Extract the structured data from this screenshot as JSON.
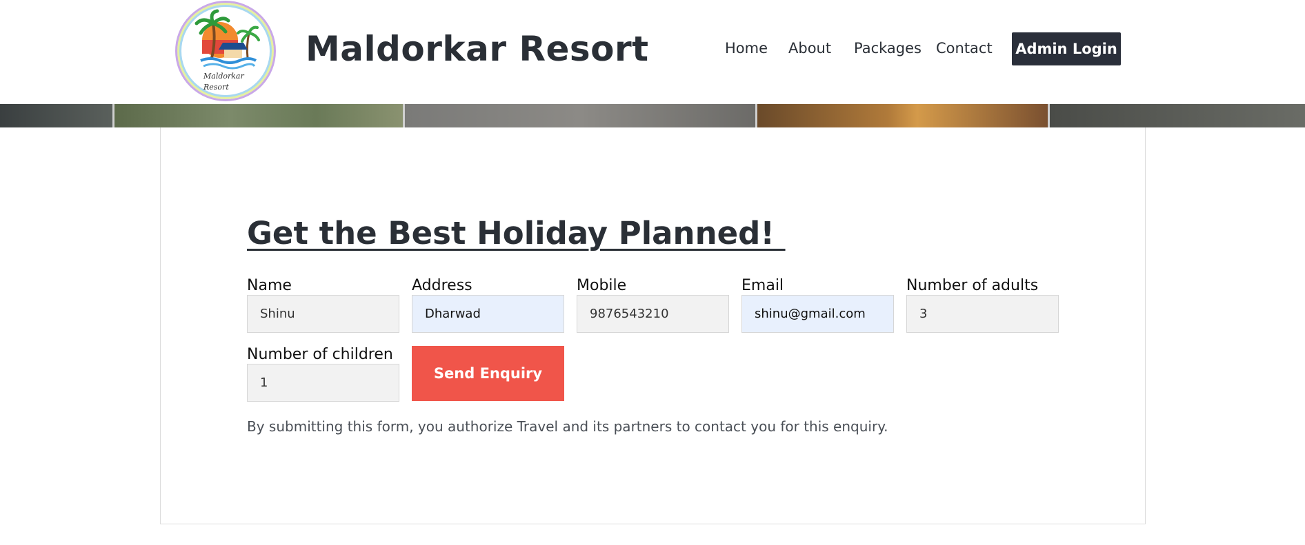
{
  "header": {
    "logo_text_line1": "Maldorkar",
    "logo_text_line2": "Resort",
    "brand": "Maldorkar Resort",
    "nav": [
      "Home",
      "About",
      "Packages",
      "Contact"
    ],
    "admin_login": "Admin Login"
  },
  "form": {
    "title": "Get the Best Holiday Planned! ",
    "fields": {
      "name": {
        "label": "Name",
        "value": "Shinu"
      },
      "address": {
        "label": "Address",
        "value": "Dharwad"
      },
      "mobile": {
        "label": "Mobile",
        "value": "9876543210"
      },
      "email": {
        "label": "Email",
        "value": "shinu@gmail.com"
      },
      "adults": {
        "label": "Number of adults",
        "value": "3"
      },
      "children": {
        "label": "Number of children",
        "value": "1"
      }
    },
    "submit": "Send Enquiry",
    "disclaimer": "By submitting this form, you authorize Travel and its partners to contact you for this enquiry."
  },
  "colors": {
    "accent": "#f0554a",
    "dark": "#2a2f3a",
    "autofill": "#e8f0fd"
  }
}
